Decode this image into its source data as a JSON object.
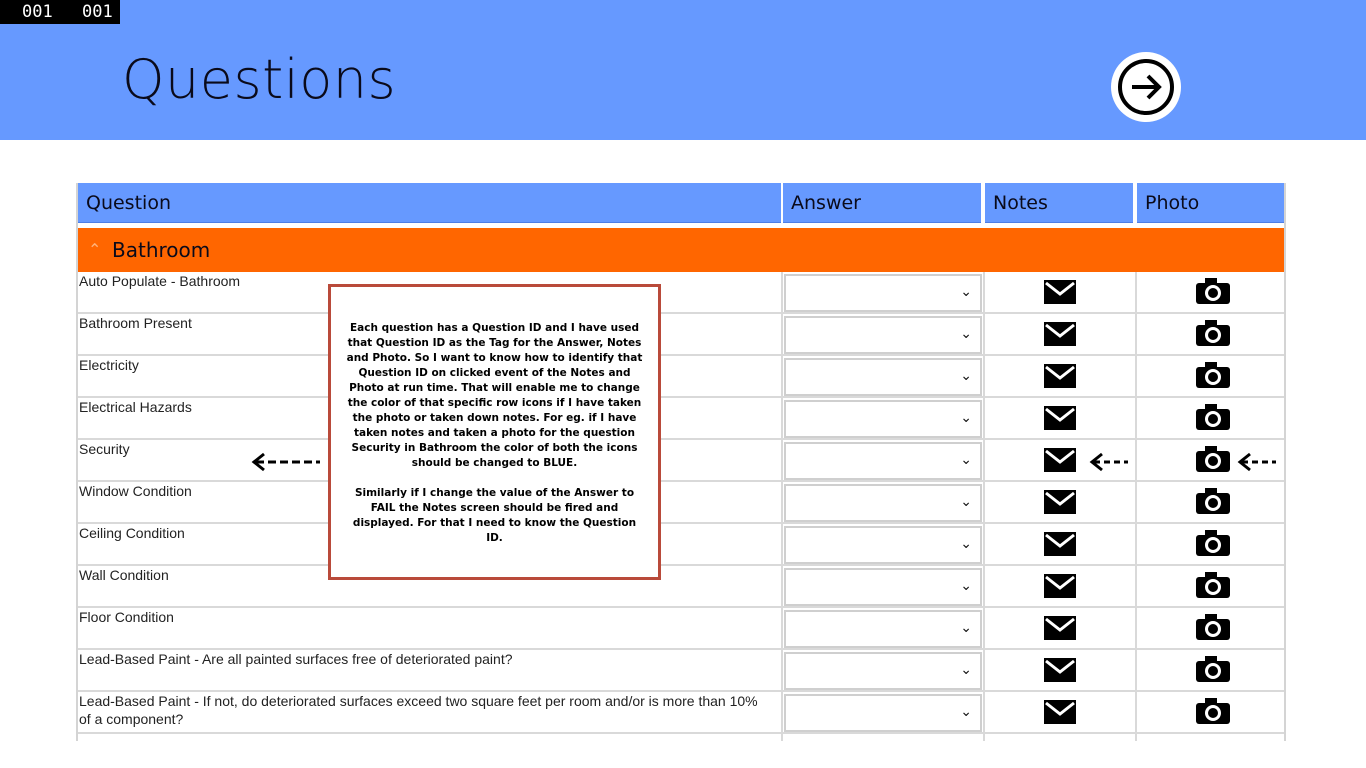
{
  "counter": {
    "left": "001",
    "right": "001"
  },
  "header": {
    "title": "Questions",
    "next_icon": "arrow-right-circle-icon"
  },
  "columns": [
    "Question",
    "Answer",
    "Notes",
    "Photo"
  ],
  "group": {
    "label": "Bathroom",
    "icon": "chevron-up-icon",
    "color": "#ff6600"
  },
  "rows": [
    {
      "question": "Auto Populate - Bathroom",
      "answer": ""
    },
    {
      "question": "Bathroom Present",
      "answer": ""
    },
    {
      "question": "Electricity",
      "answer": ""
    },
    {
      "question": "Electrical Hazards",
      "answer": ""
    },
    {
      "question": "Security",
      "answer": ""
    },
    {
      "question": "Window Condition",
      "answer": ""
    },
    {
      "question": "Ceiling Condition",
      "answer": ""
    },
    {
      "question": "Wall Condition",
      "answer": ""
    },
    {
      "question": "Floor Condition",
      "answer": ""
    },
    {
      "question": "Lead-Based Paint - Are all painted surfaces free of deteriorated paint?",
      "answer": ""
    },
    {
      "question": "Lead-Based Paint - If not, do deteriorated surfaces exceed two square feet per room and/or is more than 10% of a component?",
      "answer": ""
    }
  ],
  "annotation": {
    "paragraph1": "Each question has a Question ID and I have used that Question ID as the Tag for the Answer, Notes and Photo. So I want to know how to identify that Question ID on clicked event of the Notes and Photo at run time. That will enable me to change the color of that specific row icons if I have taken the photo or taken down notes. For eg. if I have taken notes and taken a photo for the question Security in Bathroom the color of both the icons should be changed to BLUE.",
    "paragraph2": "Similarly if I change the value of the Answer to FAIL the Notes screen should be fired and displayed. For that I need to know the Question ID."
  },
  "colors": {
    "header": "#6699ff",
    "group": "#ff6600",
    "note_border": "#b94a3a"
  }
}
